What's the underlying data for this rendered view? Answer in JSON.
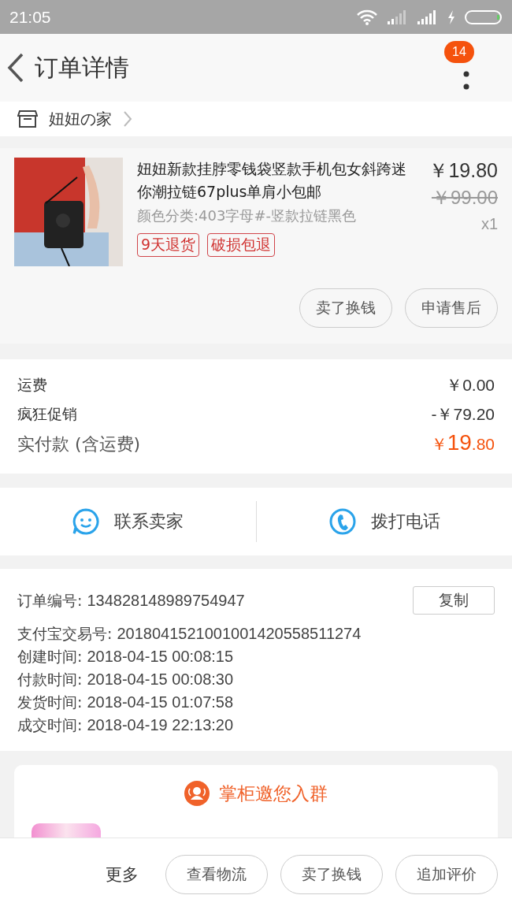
{
  "status_bar": {
    "time": "21:05"
  },
  "header": {
    "title": "订单详情",
    "badge": "14"
  },
  "shop": {
    "name": "妞妞の家"
  },
  "item": {
    "kind": "picture",
    "title": "妞妞新款挂脖零钱袋竖款手机包女斜跨迷你潮拉链67plus单肩小包邮",
    "variant": "颜色分类:403字母#-竖款拉链黑色",
    "price": "￥19.80",
    "original_price": "￥99.00",
    "quantity": "x1",
    "tags": [
      "9天退货",
      "破损包退"
    ],
    "buttons": [
      "卖了换钱",
      "申请售后"
    ]
  },
  "fees": [
    {
      "label": "运费",
      "value": "￥0.00"
    },
    {
      "label": "疯狂促销",
      "value": "-￥79.20"
    }
  ],
  "total": {
    "label": "实付款 (含运费)",
    "currency": "￥",
    "integer": "19",
    "decimal": ".80"
  },
  "contact": [
    {
      "kind": "chat",
      "label": "联系卖家"
    },
    {
      "kind": "phone",
      "label": "拨打电话"
    }
  ],
  "order_info": [
    {
      "label": "订单编号:",
      "value": "134828148989754947",
      "button": "复制"
    },
    {
      "label": "支付宝交易号:",
      "value": "2018041521001001420558511274"
    },
    {
      "label": "创建时间:",
      "value": "2018-04-15 00:08:15"
    },
    {
      "label": "付款时间:",
      "value": "2018-04-15 00:08:30"
    },
    {
      "label": "发货时间:",
      "value": "2018-04-15 01:07:58"
    },
    {
      "label": "成交时间:",
      "value": "2018-04-19 22:13:20"
    }
  ],
  "group_invite": {
    "title": "掌柜邀您入群"
  },
  "bottom_bar": {
    "more": "更多",
    "buttons": [
      "查看物流",
      "卖了换钱",
      "追加评价"
    ]
  }
}
